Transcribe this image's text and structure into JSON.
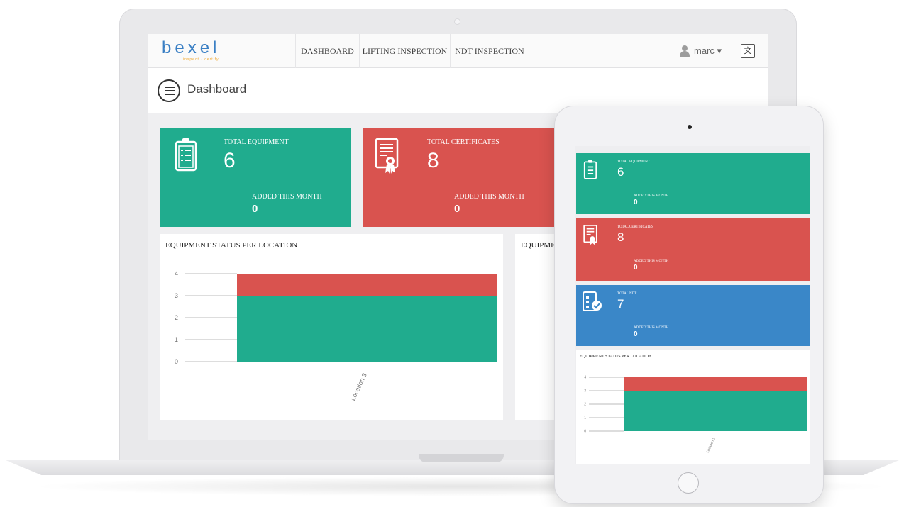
{
  "laptop": {
    "nav": {
      "logo": "bexel",
      "logo_tagline": "inspect · certify",
      "items": [
        "DASHBOARD",
        "LIFTING INSPECTION",
        "NDT INSPECTION"
      ],
      "user": "marc ▾",
      "lang_icon": "translate-icon"
    },
    "page_title": "Dashboard",
    "cards": [
      {
        "label": "TOTAL EQUIPMENT",
        "value": "6",
        "sub_label": "ADDED THIS MONTH",
        "sub_value": "0",
        "color": "#20ac8e",
        "icon": "clipboard-icon"
      },
      {
        "label": "TOTAL CERTIFICATES",
        "value": "8",
        "sub_label": "ADDED THIS MONTH",
        "sub_value": "0",
        "color": "#d9534f",
        "icon": "certificate-icon"
      }
    ],
    "panels": [
      {
        "title": "EQUIPMENT STATUS PER LOCATION"
      },
      {
        "title": "EQUIPME"
      }
    ]
  },
  "tablet": {
    "cards": [
      {
        "label": "TOTAL EQUIPMENT",
        "value": "6",
        "sub_label": "ADDED THIS MONTH",
        "sub_value": "0",
        "color": "#20ac8e",
        "icon": "clipboard-icon"
      },
      {
        "label": "TOTAL CERTIFICATES",
        "value": "8",
        "sub_label": "ADDED THIS MONTH",
        "sub_value": "0",
        "color": "#d9534f",
        "icon": "certificate-icon"
      },
      {
        "label": "TOTAL NDT",
        "value": "7",
        "sub_label": "ADDED THIS MONTH",
        "sub_value": "0",
        "color": "#3a87c8",
        "icon": "checklist-icon"
      }
    ],
    "panel_title": "EQUIPMENT STATUS PER LOCATION"
  },
  "chart_data": [
    {
      "type": "bar",
      "title": "EQUIPMENT STATUS PER LOCATION",
      "categories": [
        "Location 3"
      ],
      "stacked": true,
      "series": [
        {
          "values": [
            3
          ],
          "color": "#20ac8e"
        },
        {
          "values": [
            1
          ],
          "color": "#d9534f"
        }
      ],
      "yticks": [
        "0",
        "1",
        "2",
        "3",
        "4"
      ],
      "ylim": [
        0,
        4
      ]
    },
    {
      "type": "bar",
      "title": "EQUIPMENT STATUS PER LOCATION",
      "categories": [
        "Location 3"
      ],
      "stacked": true,
      "series": [
        {
          "values": [
            3
          ],
          "color": "#20ac8e"
        },
        {
          "values": [
            1
          ],
          "color": "#d9534f"
        }
      ],
      "yticks": [
        "0",
        "1",
        "2",
        "3",
        "4"
      ],
      "ylim": [
        0,
        4
      ]
    }
  ]
}
